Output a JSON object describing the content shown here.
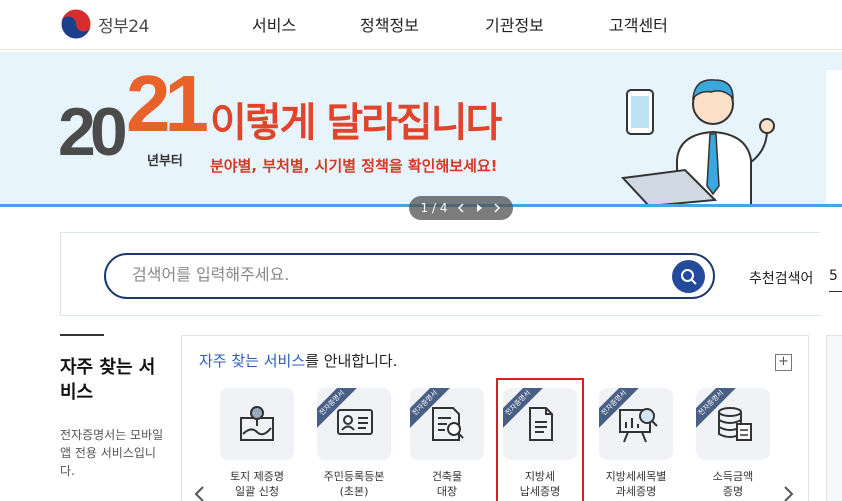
{
  "header": {
    "logo_text": "정부24",
    "nav": [
      "서비스",
      "정책정보",
      "기관정보",
      "고객센터"
    ]
  },
  "banner": {
    "year_prefix": "20",
    "year_suffix": "21",
    "since": "년부터",
    "headline": "이렇게 달라집니다",
    "subline": "분야별, 부처별, 시기별 정책을 확인해보세요!",
    "pager": {
      "text": "1 / 4",
      "prev_icon": "chevron-left-icon",
      "play_icon": "play-icon",
      "next_icon": "chevron-right-icon"
    }
  },
  "search": {
    "placeholder": "검색어를 입력해주세요.",
    "recommend_label": "추천검색어",
    "recommend_next": "5"
  },
  "frequent": {
    "title": "자주 찾는 서비스",
    "description": "전자증명서는 모바일 앱 전용 서비스입니다.",
    "panel_title_accent": "자주 찾는 서비스",
    "panel_title_rest": "를 안내합니다.",
    "more_button": "+",
    "badge": "전자증명서",
    "items": [
      {
        "line1": "토지 제증명",
        "line2": "일괄 신청",
        "icon": "map-icon",
        "badge": false
      },
      {
        "line1": "주민등록등본",
        "line2": "(초본)",
        "icon": "id-card-icon",
        "badge": true
      },
      {
        "line1": "건축물",
        "line2": "대장",
        "icon": "document-search-icon",
        "badge": true
      },
      {
        "line1": "지방세",
        "line2": "납세증명",
        "icon": "document-icon",
        "badge": true
      },
      {
        "line1": "지방세세목별",
        "line2": "과세증명",
        "icon": "chart-board-icon",
        "badge": true
      },
      {
        "line1": "소득금액",
        "line2": "증명",
        "icon": "database-icon",
        "badge": true
      }
    ]
  },
  "colors": {
    "brand_navy": "#1e3a6e",
    "accent_blue": "#2a5fc0",
    "headline_red": "#e0452b",
    "highlight_red": "#d42020"
  }
}
